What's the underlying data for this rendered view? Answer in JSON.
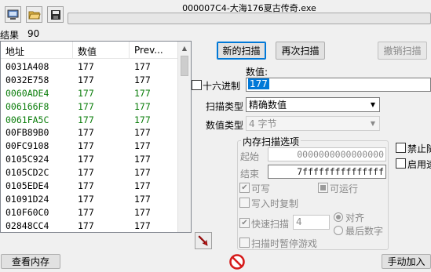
{
  "toolbar": {
    "icons": [
      "computer-icon",
      "open-folder-icon",
      "save-disk-icon"
    ]
  },
  "process": {
    "title": "000007C4-大海176夏古传奇.exe"
  },
  "results": {
    "label": "结果",
    "count": "90"
  },
  "list": {
    "headers": [
      "地址",
      "数值",
      "Prev..."
    ],
    "rows": [
      {
        "address": "0031A408",
        "value": "177",
        "prev": "177",
        "green": false
      },
      {
        "address": "0032E758",
        "value": "177",
        "prev": "177",
        "green": false
      },
      {
        "address": "0060ADE4",
        "value": "177",
        "prev": "177",
        "green": true
      },
      {
        "address": "006166F8",
        "value": "177",
        "prev": "177",
        "green": true
      },
      {
        "address": "0061FA5C",
        "value": "177",
        "prev": "177",
        "green": true
      },
      {
        "address": "00FB89B0",
        "value": "177",
        "prev": "177",
        "green": false
      },
      {
        "address": "00FC9108",
        "value": "177",
        "prev": "177",
        "green": false
      },
      {
        "address": "0105C924",
        "value": "177",
        "prev": "177",
        "green": false
      },
      {
        "address": "0105CD2C",
        "value": "177",
        "prev": "177",
        "green": false
      },
      {
        "address": "0105EDE4",
        "value": "177",
        "prev": "177",
        "green": false
      },
      {
        "address": "01091D24",
        "value": "177",
        "prev": "177",
        "green": false
      },
      {
        "address": "010F60C0",
        "value": "177",
        "prev": "177",
        "green": false
      },
      {
        "address": "02848CC4",
        "value": "177",
        "prev": "177",
        "green": false
      }
    ]
  },
  "buttons": {
    "new_scan": "新的扫描",
    "next_scan": "再次扫描",
    "undo_scan": "撤销扫描",
    "view_memory": "查看内存",
    "manual_add": "手动加入"
  },
  "scan": {
    "value_label": "数值:",
    "value": "177",
    "hex_label": "十六进制",
    "scan_type_label": "扫描类型",
    "scan_type": "精确数值",
    "value_type_label": "数值类型",
    "value_type": "4 字节"
  },
  "memory_options": {
    "title": "内存扫描选项",
    "start_label": "起始",
    "start_value": "0000000000000000",
    "stop_label": "结束",
    "stop_value": "7fffffffffffffff",
    "writable": "可写",
    "executable": "可运行",
    "copy_on_write": "写入时复制",
    "fast_scan": "快速扫描",
    "fast_scan_value": "4",
    "alignment": "对齐",
    "last_digits": "最后数字",
    "pause_game": "扫描时暂停游戏"
  },
  "side_options": {
    "disable_random": "禁止随",
    "enable_speedhack": "启用速"
  }
}
